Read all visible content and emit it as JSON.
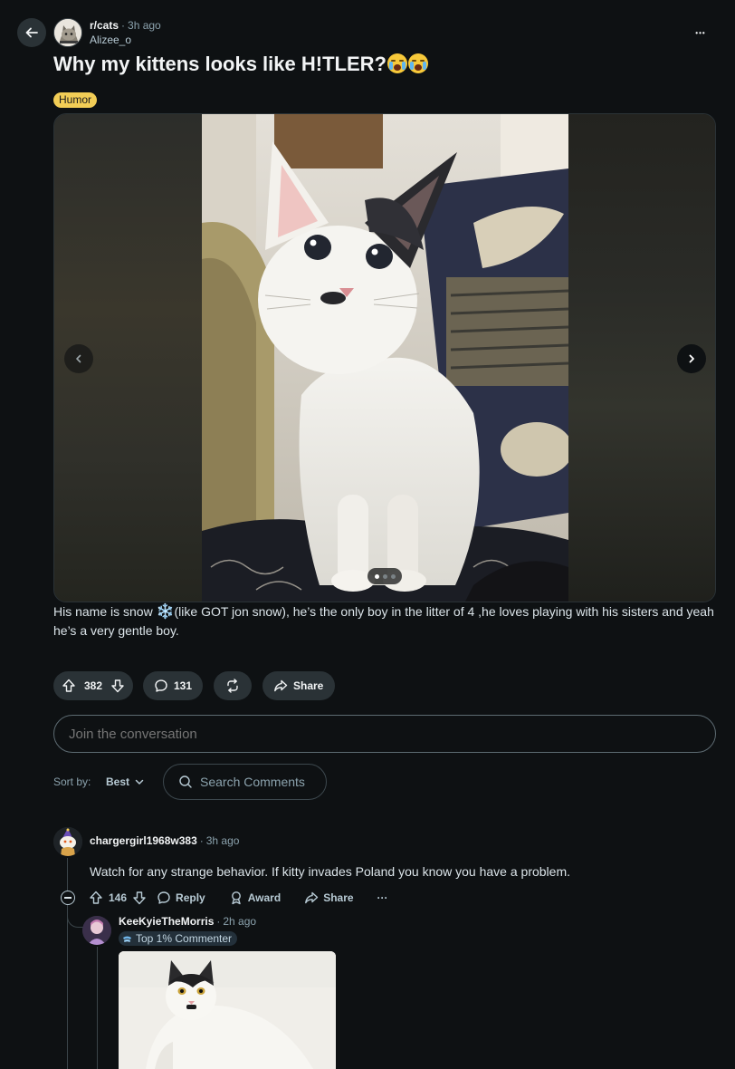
{
  "header": {
    "subreddit": "r/cats",
    "separator": "·",
    "time": "3h ago",
    "author": "Alizee_o",
    "more_label": "•••",
    "title": "Why my kittens looks like H!TLER?",
    "flair": "Humor"
  },
  "gallery": {
    "dots": 3,
    "active_dot": 1
  },
  "post": {
    "body_pre": "His name is snow ",
    "body_emoji": "❄️",
    "body_post": "(like GOT jon snow), he’s the only boy in the litter of 4 ,he loves playing with his sisters and yeah he’s a very gentle boy."
  },
  "actions": {
    "upvotes": "382",
    "comments": "131",
    "share": "Share"
  },
  "composer": {
    "placeholder": "Join the conversation"
  },
  "sort": {
    "label": "Sort by:",
    "value": "Best",
    "search_placeholder": "Search Comments"
  },
  "comments": [
    {
      "user": "chargergirl1968w383",
      "separator": "·",
      "time": "3h ago",
      "body": "Watch for any strange behavior. If kitty invades Poland you know you have a problem.",
      "score": "146",
      "reply": "Reply",
      "award": "Award",
      "share": "Share",
      "more": "···"
    },
    {
      "user": "KeeKyieTheMorris",
      "separator": "·",
      "time": "2h ago",
      "badge": "Top 1% Commenter"
    }
  ],
  "colors": {
    "background": "#0e1113",
    "pill": "#2a3236",
    "flair": "#f2cd56",
    "text": "#f2f4f5",
    "muted": "#8ba2ad"
  },
  "icons": [
    "back-arrow-icon",
    "more-icon",
    "chevron-left-icon",
    "chevron-right-icon",
    "upvote-icon",
    "downvote-icon",
    "comment-icon",
    "repost-icon",
    "share-icon",
    "chevron-down-icon",
    "search-icon",
    "minus-icon",
    "award-icon",
    "badge-icon"
  ]
}
